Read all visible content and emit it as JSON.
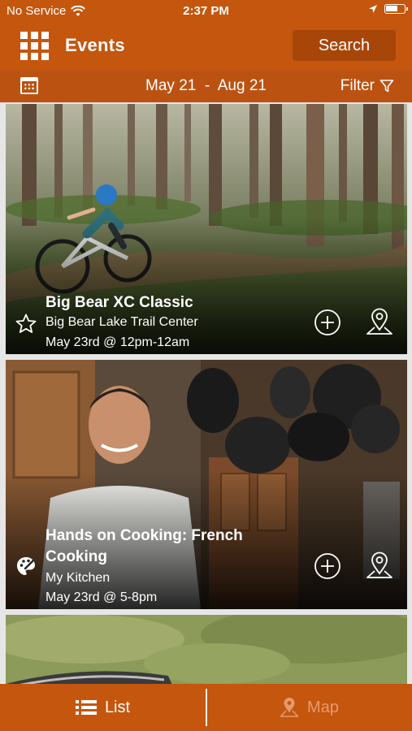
{
  "status_bar": {
    "carrier": "No Service",
    "time": "2:37 PM"
  },
  "nav": {
    "title": "Events",
    "search_label": "Search"
  },
  "date_bar": {
    "start": "May 21",
    "separator": "-",
    "end": "Aug 21",
    "filter_label": "Filter"
  },
  "events": [
    {
      "title": "Big Bear XC Classic",
      "venue": "Big Bear Lake Trail Center",
      "when": "May 23rd @ 12pm-12am",
      "category_icon": "star-icon"
    },
    {
      "title": "Hands on Cooking: French Cooking",
      "venue": "My Kitchen",
      "when": "May 23rd @ 5-8pm",
      "category_icon": "palette-icon"
    }
  ],
  "tabs": [
    {
      "label": "List",
      "icon": "list-icon",
      "active": true
    },
    {
      "label": "Map",
      "icon": "map-pin-icon",
      "active": false
    }
  ],
  "colors": {
    "brand": "#c4560e",
    "brand_dark": "#a8460a",
    "inactive_tab": "#e59a6d"
  }
}
